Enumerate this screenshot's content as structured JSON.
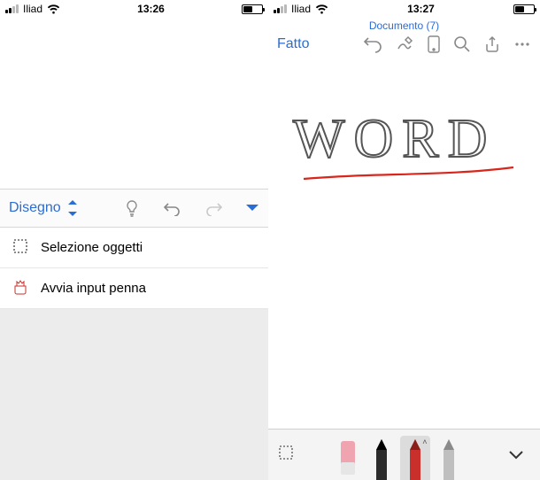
{
  "left": {
    "status": {
      "carrier": "Iliad",
      "time": "13:26",
      "battery_pct": 45
    },
    "toolbar": {
      "mode_label": "Disegno"
    },
    "menu": {
      "item1": "Selezione oggetti",
      "item2": "Avvia input penna"
    }
  },
  "right": {
    "status": {
      "carrier": "Iliad",
      "time": "13:27",
      "battery_pct": 45
    },
    "document_name": "Documento (7)",
    "done_label": "Fatto",
    "handwriting_text": "WORD"
  }
}
